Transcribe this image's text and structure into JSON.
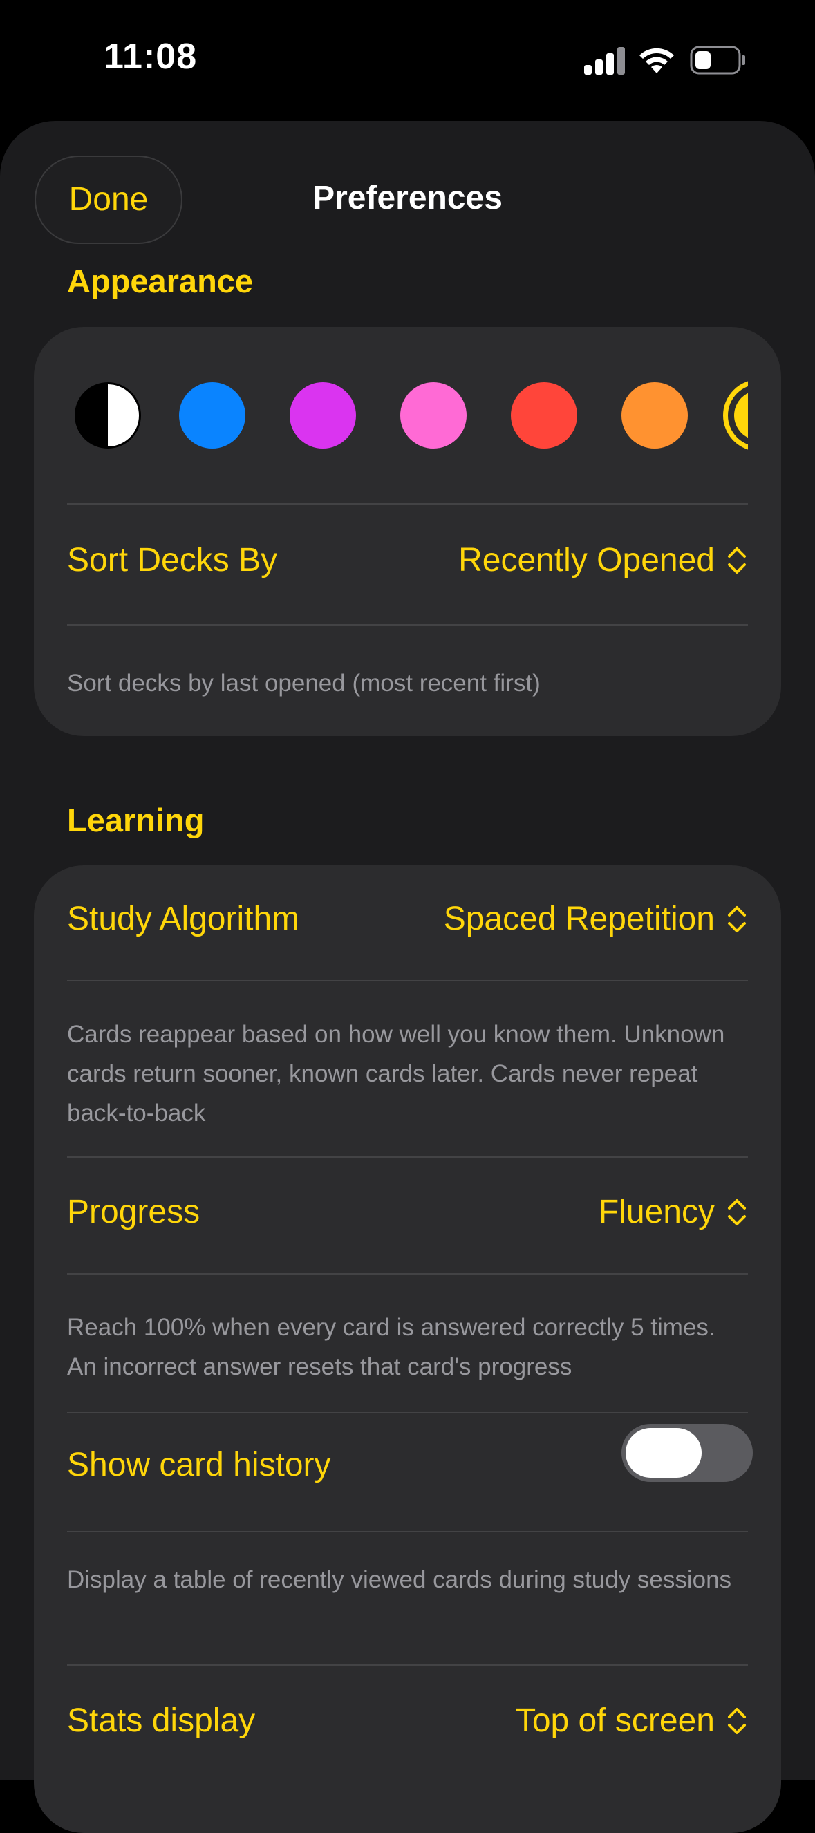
{
  "status_bar": {
    "time": "11:08"
  },
  "header": {
    "done_label": "Done",
    "title": "Preferences"
  },
  "appearance": {
    "section_title": "Appearance",
    "swatch_colors": [
      "#000000/#ffffff",
      "#0a84ff",
      "#da34f0",
      "#ff6ad5",
      "#ff453a",
      "#ff9230",
      "#ffd60a"
    ],
    "sort_label": "Sort Decks By",
    "sort_value": "Recently Opened",
    "sort_footnote": "Sort decks by last opened (most recent first)"
  },
  "learning": {
    "section_title": "Learning",
    "algorithm_label": "Study Algorithm",
    "algorithm_value": "Spaced Repetition",
    "algorithm_footnote": "Cards reappear based on how well you know them. Unknown cards return sooner, known cards later. Cards never repeat back-to-back",
    "progress_label": "Progress",
    "progress_value": "Fluency",
    "progress_footnote": "Reach 100% when every card is answered correctly 5 times. An incorrect answer resets that card's progress",
    "history_label": "Show card history",
    "history_enabled": false,
    "history_footnote": "Display a table of recently viewed cards during study sessions",
    "stats_label": "Stats display",
    "stats_value": "Top of screen"
  },
  "colors": {
    "accent": "#ffd60a",
    "sheet_background": "#1c1c1e",
    "card_background": "#2c2c2e",
    "secondary_text": "#98989d"
  }
}
